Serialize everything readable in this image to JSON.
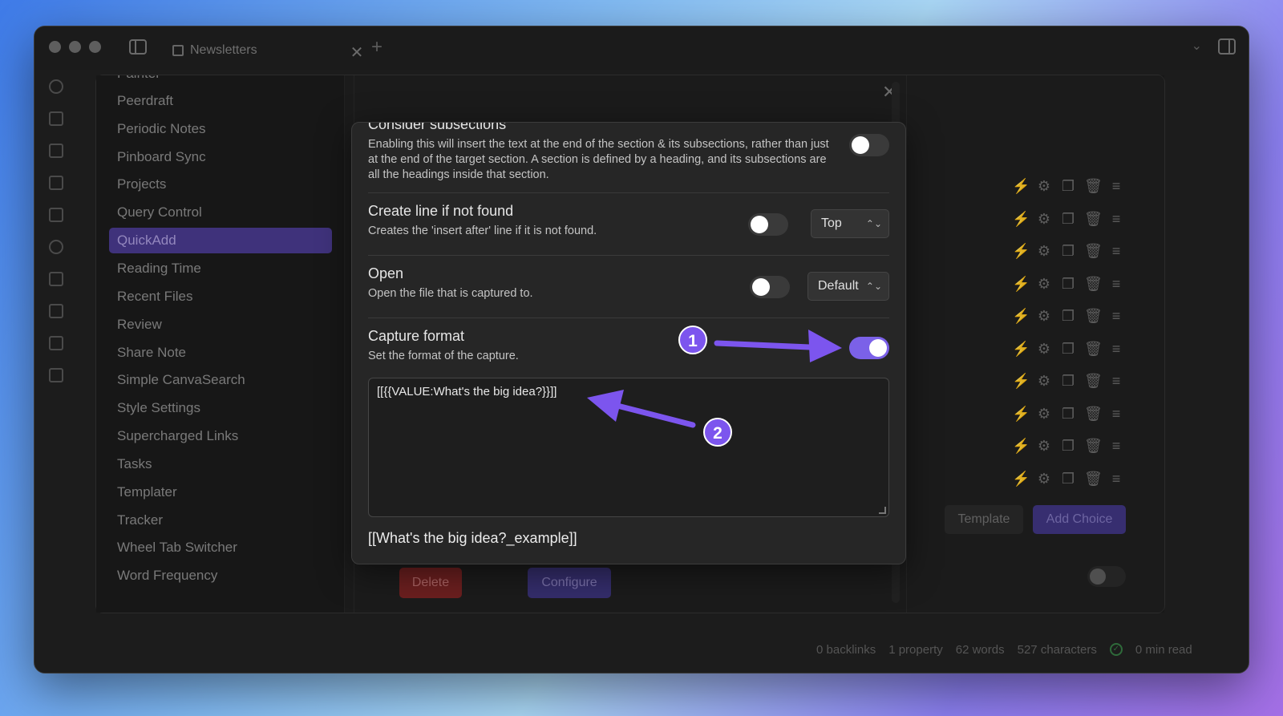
{
  "titlebar": {
    "tab_title": "Newsletters"
  },
  "sidebar": {
    "items": [
      {
        "label": "Painter"
      },
      {
        "label": "Peerdraft"
      },
      {
        "label": "Periodic Notes"
      },
      {
        "label": "Pinboard Sync"
      },
      {
        "label": "Projects"
      },
      {
        "label": "Query Control"
      },
      {
        "label": "QuickAdd",
        "active": true
      },
      {
        "label": "Reading Time"
      },
      {
        "label": "Recent Files"
      },
      {
        "label": "Review"
      },
      {
        "label": "Share Note"
      },
      {
        "label": "Simple CanvaSearch"
      },
      {
        "label": "Style Settings"
      },
      {
        "label": "Supercharged Links"
      },
      {
        "label": "Tasks"
      },
      {
        "label": "Templater"
      },
      {
        "label": "Tracker"
      },
      {
        "label": "Wheel Tab Switcher"
      },
      {
        "label": "Word Frequency"
      }
    ]
  },
  "background_panel": {
    "template_button": "Template",
    "add_choice_button": "Add Choice",
    "delete_button": "Delete",
    "configure_button": "Configure"
  },
  "modal": {
    "consider_subsections": {
      "title": "Consider subsections",
      "desc": "Enabling this will insert the text at the end of the section & its subsections, rather than just at the end of the target section. A section is defined by a heading, and its subsections are all the headings inside that section.",
      "enabled": false
    },
    "create_line": {
      "title": "Create line if not found",
      "desc": "Creates the 'insert after' line if it is not found.",
      "enabled": false,
      "select_value": "Top"
    },
    "open": {
      "title": "Open",
      "desc": "Open the file that is captured to.",
      "enabled": false,
      "select_value": "Default"
    },
    "capture_format": {
      "title": "Capture format",
      "desc": "Set the format of the capture.",
      "enabled": true,
      "value": "[[{{VALUE:What's the big idea?}}]]",
      "preview": "[[What's the big idea?_example]]"
    }
  },
  "annotations": {
    "badge1": "1",
    "badge2": "2",
    "accent": "#7c55ee"
  },
  "statusbar": {
    "backlinks": "0 backlinks",
    "property": "1 property",
    "words": "62 words",
    "characters": "527 characters",
    "read": "0 min read"
  }
}
